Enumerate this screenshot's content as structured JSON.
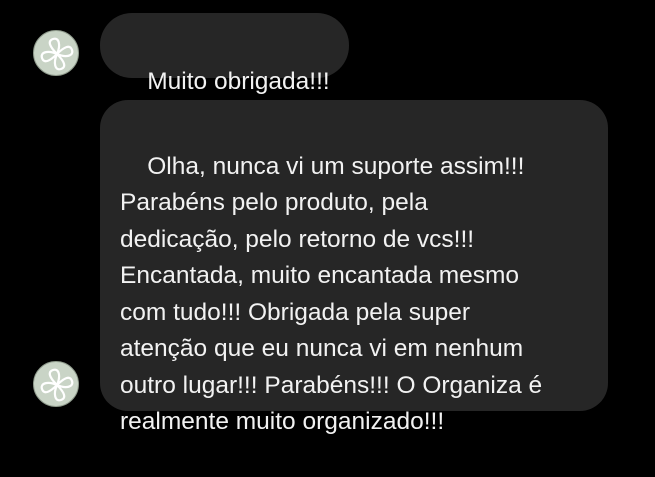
{
  "messages": [
    {
      "avatar_icon": "leaf-logo-icon",
      "text": "Muito obrigada!!!"
    },
    {
      "avatar_icon": "leaf-logo-icon",
      "text": "Olha, nunca vi um suporte assim!!!\nParabéns pelo produto, pela\ndedicação, pelo retorno de vcs!!!\nEncantada, muito encantada mesmo\ncom tudo!!! Obrigada pela super\natenção que eu nunca vi em nenhum\noutro lugar!!! Parabéns!!! O Organiza é\nrealmente muito organizado!!!"
    }
  ],
  "colors": {
    "background": "#000000",
    "bubble": "#262626",
    "text": "#f2f2f2",
    "avatar_fill": "#c9d4c6",
    "avatar_mark": "#ffffff"
  }
}
